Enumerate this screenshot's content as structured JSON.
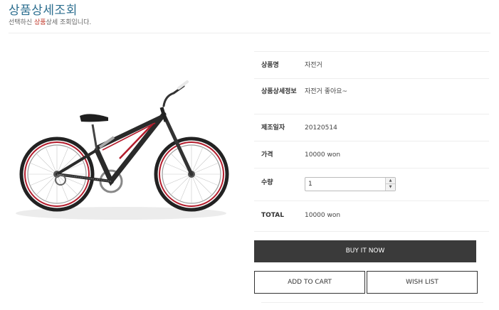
{
  "header": {
    "title": "상품상세조회",
    "subtitle_before": "선택하신 ",
    "subtitle_highlight": "상품",
    "subtitle_after": "상세 조회입니다."
  },
  "product": {
    "image_icon": "bicycle-icon",
    "name_label": "상품명",
    "name_value": "자전거",
    "desc_label": "상품상세정보",
    "desc_value": "자전거 좋아요~",
    "date_label": "제조일자",
    "date_value": "20120514",
    "price_label": "가격",
    "price_value": "10000 won",
    "qty_label": "수량",
    "qty_value": "1",
    "total_label": "TOTAL",
    "total_value": "10000 won"
  },
  "actions": {
    "buy_label": "BUY IT NOW",
    "cart_label": "ADD TO CART",
    "wish_label": "WISH LIST"
  },
  "colors": {
    "title": "#2c6e8f",
    "highlight": "#c0392b",
    "buy_button_bg": "#3a3a3a"
  }
}
